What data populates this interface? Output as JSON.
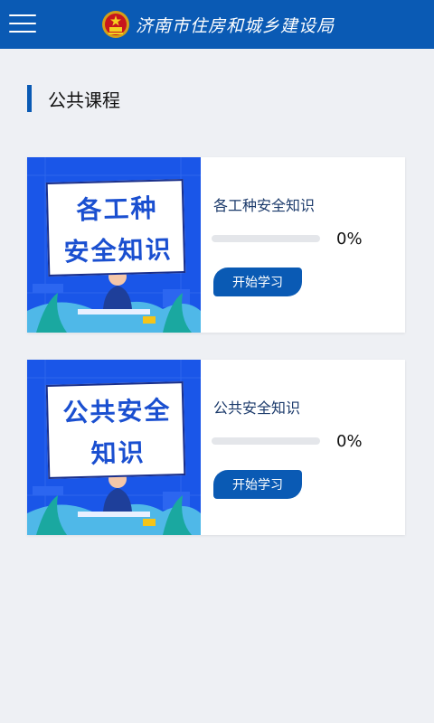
{
  "header": {
    "title": "济南市住房和城乡建设局",
    "menu_icon": "hamburger-icon",
    "emblem_icon": "national-emblem-icon"
  },
  "section": {
    "title": "公共课程"
  },
  "colors": {
    "primary": "#0a5ab4",
    "thumb_bg": "#1a56e8",
    "background": "#eef0f4"
  },
  "courses": [
    {
      "title": "各工种安全知识",
      "thumb_line1": "各工种",
      "thumb_line2": "安全知识",
      "progress": 0,
      "progress_label": "0%",
      "button_label": "开始学习"
    },
    {
      "title": "公共安全知识",
      "thumb_line1": "公共安全",
      "thumb_line2": "知识",
      "progress": 0,
      "progress_label": "0%",
      "button_label": "开始学习"
    }
  ]
}
